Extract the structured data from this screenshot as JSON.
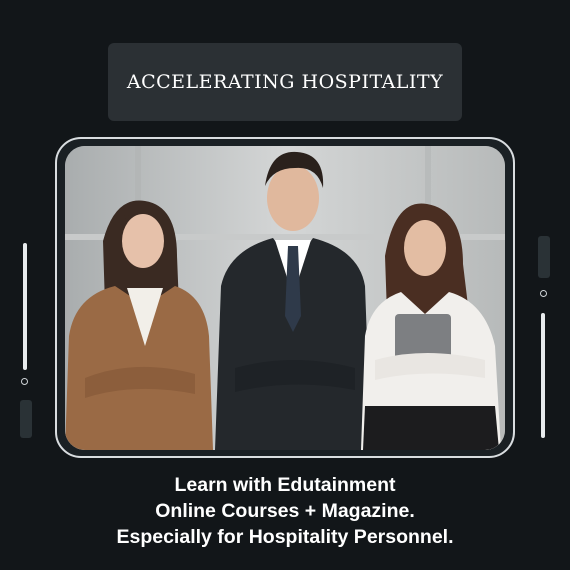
{
  "header": {
    "title": "ACCELERATING HOSPITALITY"
  },
  "photo": {
    "subject": "three professionals"
  },
  "caption": {
    "line1": "Learn with Edutainment",
    "line2": "Online Courses + Magazine.",
    "line3": "Especially for Hospitality Personnel."
  },
  "colors": {
    "background": "#121619",
    "title_box": "#2b3034",
    "frame": "#d9dde0"
  }
}
